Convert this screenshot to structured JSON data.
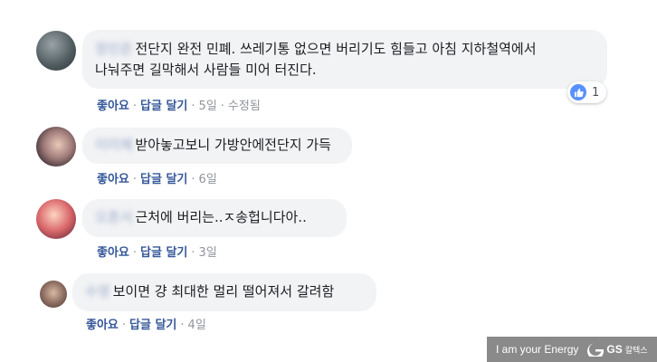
{
  "comments": [
    {
      "author": "정민준",
      "text_line1": "전단지 완전 민폐. 쓰레기통 없으면 버리기도 힘들고 아침 지하철역에서",
      "text_line2": "나눠주면 길막해서 사람들 미어 터진다.",
      "like_label": "좋아요",
      "reply_label": "답글 달기",
      "time": "5일",
      "edited": "수정됨",
      "reaction_count": "1"
    },
    {
      "author": "이미혜",
      "text": "받아놓고보니 가방안에전단지 가득",
      "like_label": "좋아요",
      "reply_label": "답글 달기",
      "time": "6일"
    },
    {
      "author": "오혼서",
      "text": "근처에 버리는..ㅈ송헙니다아..",
      "like_label": "좋아요",
      "reply_label": "답글 달기",
      "time": "3일"
    },
    {
      "author": "수영",
      "text": "보이면 걍 최대한 멀리 떨어져서 갈려함",
      "like_label": "좋아요",
      "reply_label": "답글 달기",
      "time": "4일"
    }
  ],
  "separator": "·",
  "watermark": {
    "tagline": "I am your Energy",
    "brand": "GS",
    "brand_sub": "칼텍스"
  },
  "colors": {
    "bubble": "#f2f3f5",
    "link": "#365899",
    "meta": "#90949c",
    "like_blue": "#5890ff"
  }
}
